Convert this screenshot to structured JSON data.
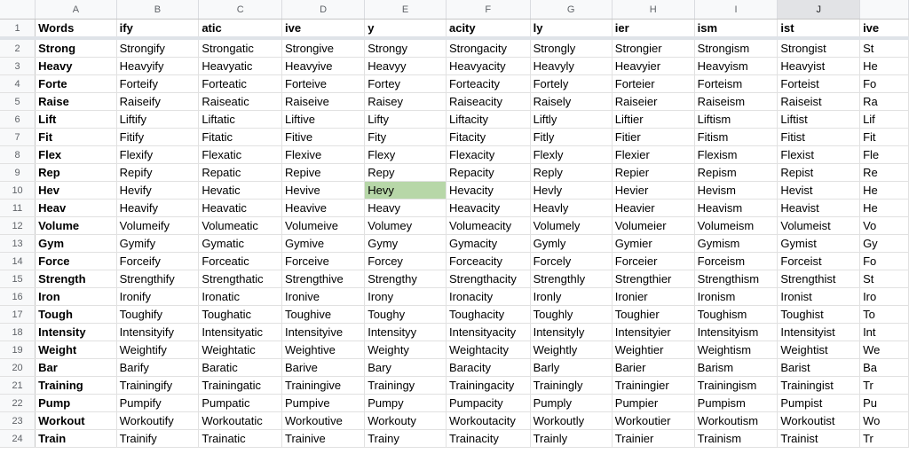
{
  "columns": [
    "A",
    "B",
    "C",
    "D",
    "E",
    "F",
    "G",
    "H",
    "I",
    "J",
    ""
  ],
  "selected_column": "J",
  "highlight": {
    "row": 10,
    "col": 4,
    "color": "#b7d7a8"
  },
  "rows": [
    {
      "num": "1",
      "cells": [
        "Words",
        "ify",
        "atic",
        "ive",
        "y",
        "acity",
        "ly",
        "ier",
        "ism",
        "ist",
        "ive"
      ]
    },
    {
      "num": "2",
      "cells": [
        "Strong",
        "Strongify",
        "Strongatic",
        "Strongive",
        "Strongy",
        "Strongacity",
        "Strongly",
        "Strongier",
        "Strongism",
        "Strongist",
        "St"
      ]
    },
    {
      "num": "3",
      "cells": [
        "Heavy",
        "Heavyify",
        "Heavyatic",
        "Heavyive",
        "Heavyy",
        "Heavyacity",
        "Heavyly",
        "Heavyier",
        "Heavyism",
        "Heavyist",
        "He"
      ]
    },
    {
      "num": "4",
      "cells": [
        "Forte",
        "Forteify",
        "Forteatic",
        "Forteive",
        "Fortey",
        "Forteacity",
        "Fortely",
        "Forteier",
        "Forteism",
        "Forteist",
        "Fo"
      ]
    },
    {
      "num": "5",
      "cells": [
        "Raise",
        "Raiseify",
        "Raiseatic",
        "Raiseive",
        "Raisey",
        "Raiseacity",
        "Raisely",
        "Raiseier",
        "Raiseism",
        "Raiseist",
        "Ra"
      ]
    },
    {
      "num": "6",
      "cells": [
        "Lift",
        "Liftify",
        "Liftatic",
        "Liftive",
        "Lifty",
        "Liftacity",
        "Liftly",
        "Liftier",
        "Liftism",
        "Liftist",
        "Lif"
      ]
    },
    {
      "num": "7",
      "cells": [
        "Fit",
        "Fitify",
        "Fitatic",
        "Fitive",
        "Fity",
        "Fitacity",
        "Fitly",
        "Fitier",
        "Fitism",
        "Fitist",
        "Fit"
      ]
    },
    {
      "num": "8",
      "cells": [
        "Flex",
        "Flexify",
        "Flexatic",
        "Flexive",
        "Flexy",
        "Flexacity",
        "Flexly",
        "Flexier",
        "Flexism",
        "Flexist",
        "Fle"
      ]
    },
    {
      "num": "9",
      "cells": [
        "Rep",
        "Repify",
        "Repatic",
        "Repive",
        "Repy",
        "Repacity",
        "Reply",
        "Repier",
        "Repism",
        "Repist",
        "Re"
      ]
    },
    {
      "num": "10",
      "cells": [
        "Hev",
        "Hevify",
        "Hevatic",
        "Hevive",
        "Hevy",
        "Hevacity",
        "Hevly",
        "Hevier",
        "Hevism",
        "Hevist",
        "He"
      ]
    },
    {
      "num": "11",
      "cells": [
        "Heav",
        "Heavify",
        "Heavatic",
        "Heavive",
        "Heavy",
        "Heavacity",
        "Heavly",
        "Heavier",
        "Heavism",
        "Heavist",
        "He"
      ]
    },
    {
      "num": "12",
      "cells": [
        "Volume",
        "Volumeify",
        "Volumeatic",
        "Volumeive",
        "Volumey",
        "Volumeacity",
        "Volumely",
        "Volumeier",
        "Volumeism",
        "Volumeist",
        "Vo"
      ]
    },
    {
      "num": "13",
      "cells": [
        "Gym",
        "Gymify",
        "Gymatic",
        "Gymive",
        "Gymy",
        "Gymacity",
        "Gymly",
        "Gymier",
        "Gymism",
        "Gymist",
        "Gy"
      ]
    },
    {
      "num": "14",
      "cells": [
        "Force",
        "Forceify",
        "Forceatic",
        "Forceive",
        "Forcey",
        "Forceacity",
        "Forcely",
        "Forceier",
        "Forceism",
        "Forceist",
        "Fo"
      ]
    },
    {
      "num": "15",
      "cells": [
        "Strength",
        "Strengthify",
        "Strengthatic",
        "Strengthive",
        "Strengthy",
        "Strengthacity",
        "Strengthly",
        "Strengthier",
        "Strengthism",
        "Strengthist",
        "St"
      ]
    },
    {
      "num": "16",
      "cells": [
        "Iron",
        "Ironify",
        "Ironatic",
        "Ironive",
        "Irony",
        "Ironacity",
        "Ironly",
        "Ironier",
        "Ironism",
        "Ironist",
        "Iro"
      ]
    },
    {
      "num": "17",
      "cells": [
        "Tough",
        "Toughify",
        "Toughatic",
        "Toughive",
        "Toughy",
        "Toughacity",
        "Toughly",
        "Toughier",
        "Toughism",
        "Toughist",
        "To"
      ]
    },
    {
      "num": "18",
      "cells": [
        "Intensity",
        "Intensityify",
        "Intensityatic",
        "Intensityive",
        "Intensityy",
        "Intensityacity",
        "Intensityly",
        "Intensityier",
        "Intensityism",
        "Intensityist",
        "Int"
      ]
    },
    {
      "num": "19",
      "cells": [
        "Weight",
        "Weightify",
        "Weightatic",
        "Weightive",
        "Weighty",
        "Weightacity",
        "Weightly",
        "Weightier",
        "Weightism",
        "Weightist",
        "We"
      ]
    },
    {
      "num": "20",
      "cells": [
        "Bar",
        "Barify",
        "Baratic",
        "Barive",
        "Bary",
        "Baracity",
        "Barly",
        "Barier",
        "Barism",
        "Barist",
        "Ba"
      ]
    },
    {
      "num": "21",
      "cells": [
        "Training",
        "Trainingify",
        "Trainingatic",
        "Trainingive",
        "Trainingy",
        "Trainingacity",
        "Trainingly",
        "Trainingier",
        "Trainingism",
        "Trainingist",
        "Tr"
      ]
    },
    {
      "num": "22",
      "cells": [
        "Pump",
        "Pumpify",
        "Pumpatic",
        "Pumpive",
        "Pumpy",
        "Pumpacity",
        "Pumply",
        "Pumpier",
        "Pumpism",
        "Pumpist",
        "Pu"
      ]
    },
    {
      "num": "23",
      "cells": [
        "Workout",
        "Workoutify",
        "Workoutatic",
        "Workoutive",
        "Workouty",
        "Workoutacity",
        "Workoutly",
        "Workoutier",
        "Workoutism",
        "Workoutist",
        "Wo"
      ]
    },
    {
      "num": "24",
      "cells": [
        "Train",
        "Trainify",
        "Trainatic",
        "Trainive",
        "Trainy",
        "Trainacity",
        "Trainly",
        "Trainier",
        "Trainism",
        "Trainist",
        "Tr"
      ]
    }
  ]
}
